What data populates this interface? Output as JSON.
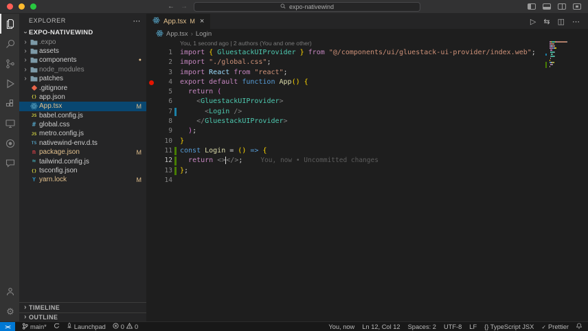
{
  "titlebar": {
    "search_value": "expo-nativewind"
  },
  "activity_bar": {
    "items": [
      "explorer",
      "search",
      "source-control",
      "run-and-debug",
      "extensions",
      "remote-explorer",
      "live-share",
      "chat"
    ],
    "bottom_items": [
      "accounts",
      "settings"
    ]
  },
  "sidebar": {
    "header": "EXPLORER",
    "root": {
      "label": "EXPO-NATIVEWIND"
    },
    "files": [
      {
        "label": ".expo",
        "kind": "folder",
        "icon": "folder",
        "dim": true
      },
      {
        "label": "assets",
        "kind": "folder",
        "icon": "folder"
      },
      {
        "label": "components",
        "kind": "folder",
        "icon": "folder",
        "badge": "●"
      },
      {
        "label": "node_modules",
        "kind": "folder",
        "icon": "folder",
        "dim": true
      },
      {
        "label": "patches",
        "kind": "folder",
        "icon": "folder"
      },
      {
        "label": ".gitignore",
        "kind": "file",
        "icon": "git"
      },
      {
        "label": "app.json",
        "kind": "file",
        "icon": "json"
      },
      {
        "label": "App.tsx",
        "kind": "file",
        "icon": "react",
        "badge": "M",
        "selected": true,
        "modified": true
      },
      {
        "label": "babel.config.js",
        "kind": "file",
        "icon": "js"
      },
      {
        "label": "global.css",
        "kind": "file",
        "icon": "css"
      },
      {
        "label": "metro.config.js",
        "kind": "file",
        "icon": "js"
      },
      {
        "label": "nativewind-env.d.ts",
        "kind": "file",
        "icon": "ts"
      },
      {
        "label": "package.json",
        "kind": "file",
        "icon": "npm",
        "badge": "M",
        "modified": true
      },
      {
        "label": "tailwind.config.js",
        "kind": "file",
        "icon": "tailwind"
      },
      {
        "label": "tsconfig.json",
        "kind": "file",
        "icon": "json"
      },
      {
        "label": "yarn.lock",
        "kind": "file",
        "icon": "yarn",
        "badge": "M",
        "modified": true
      }
    ],
    "panels": [
      {
        "label": "TIMELINE"
      },
      {
        "label": "OUTLINE"
      }
    ]
  },
  "editor": {
    "tabs": [
      {
        "label": "App.tsx",
        "git_badge": "M",
        "icon": "react"
      }
    ],
    "breadcrumb": [
      {
        "label": "App.tsx"
      },
      {
        "label": "Login"
      }
    ],
    "codelens": "You, 1 second ago | 2 authors (You and one other)",
    "inline_blame": "You, now • Uncommitted changes",
    "cursor": {
      "line": 12,
      "col": 12
    },
    "breakpoint_line": 4,
    "lines": [
      {
        "n": 1,
        "tk": [
          [
            "kw",
            "import "
          ],
          [
            "b1",
            "{ "
          ],
          [
            "ty",
            "GluestackUIProvider"
          ],
          [
            "b1",
            " }"
          ],
          [
            "kw",
            " from "
          ],
          [
            "st",
            "\"@/components/ui/gluestack-ui-provider/index.web\""
          ],
          [
            "pl",
            ";"
          ]
        ]
      },
      {
        "n": 2,
        "tk": [
          [
            "kw",
            "import "
          ],
          [
            "st",
            "\"./global.css\""
          ],
          [
            "pl",
            ";"
          ]
        ]
      },
      {
        "n": 3,
        "tk": [
          [
            "kw",
            "import "
          ],
          [
            "id",
            "React"
          ],
          [
            "kw",
            " from "
          ],
          [
            "st",
            "\"react\""
          ],
          [
            "pl",
            ";"
          ]
        ]
      },
      {
        "n": 4,
        "bp": true,
        "tk": [
          [
            "kw",
            "export default "
          ],
          [
            "k2",
            "function "
          ],
          [
            "fn",
            "App"
          ],
          [
            "b1",
            "()"
          ],
          [
            "pl",
            " "
          ],
          [
            "b1",
            "{"
          ]
        ]
      },
      {
        "n": 5,
        "tk": [
          [
            "pl",
            "  "
          ],
          [
            "kw",
            "return "
          ],
          [
            "b2",
            "("
          ]
        ]
      },
      {
        "n": 6,
        "tk": [
          [
            "pl",
            "    "
          ],
          [
            "tg",
            "<"
          ],
          [
            "ty",
            "GluestackUIProvider"
          ],
          [
            "tg",
            ">"
          ]
        ]
      },
      {
        "n": 7,
        "chg": "mod",
        "tk": [
          [
            "pl",
            "      "
          ],
          [
            "tg",
            "<"
          ],
          [
            "ty",
            "Login"
          ],
          [
            "tg",
            " />"
          ]
        ]
      },
      {
        "n": 8,
        "tk": [
          [
            "pl",
            "    "
          ],
          [
            "tg",
            "</"
          ],
          [
            "ty",
            "GluestackUIProvider"
          ],
          [
            "tg",
            ">"
          ]
        ]
      },
      {
        "n": 9,
        "tk": [
          [
            "pl",
            "  "
          ],
          [
            "b2",
            ")"
          ],
          [
            "pl",
            ";"
          ]
        ]
      },
      {
        "n": 10,
        "tk": [
          [
            "b1",
            "}"
          ]
        ]
      },
      {
        "n": 11,
        "chg": "add",
        "tk": [
          [
            "k2",
            "const "
          ],
          [
            "fn",
            "Login"
          ],
          [
            "pl",
            " = "
          ],
          [
            "b1",
            "()"
          ],
          [
            "k2",
            " =>"
          ],
          [
            "pl",
            " "
          ],
          [
            "b1",
            "{"
          ]
        ]
      },
      {
        "n": 12,
        "chg": "add",
        "active": true,
        "tk": [
          [
            "pl",
            "  "
          ],
          [
            "kw",
            "return "
          ],
          [
            "tg",
            "<>"
          ],
          [
            "cu",
            ""
          ],
          [
            "tg",
            "</>"
          ],
          [
            "pl",
            ";"
          ],
          [
            "gh",
            "You, now • Uncommitted changes"
          ]
        ]
      },
      {
        "n": 13,
        "chg": "add",
        "tk": [
          [
            "b1",
            "}"
          ],
          [
            "pl",
            ";"
          ]
        ]
      },
      {
        "n": 14,
        "tk": []
      }
    ]
  },
  "status_bar": {
    "left": [
      {
        "name": "remote-indicator",
        "segments": [
          [
            "icon",
            "remote"
          ]
        ]
      },
      {
        "name": "git-branch",
        "segments": [
          [
            "icon",
            "branch"
          ],
          [
            "text",
            "main*"
          ]
        ]
      },
      {
        "name": "sync-changes",
        "segments": [
          [
            "icon",
            "sync"
          ]
        ]
      },
      {
        "name": "launchpad",
        "segments": [
          [
            "icon",
            "rocket"
          ],
          [
            "text",
            "Launchpad"
          ]
        ]
      },
      {
        "name": "problems",
        "segments": [
          [
            "icon",
            "error"
          ],
          [
            "text",
            "0"
          ],
          [
            "icon",
            "warning"
          ],
          [
            "text",
            "0"
          ]
        ]
      }
    ],
    "right": [
      {
        "name": "git-blame",
        "segments": [
          [
            "text",
            "You, now"
          ]
        ]
      },
      {
        "name": "cursor-position",
        "segments": [
          [
            "text",
            "Ln 12, Col 12"
          ]
        ]
      },
      {
        "name": "indentation",
        "segments": [
          [
            "text",
            "Spaces: 2"
          ]
        ]
      },
      {
        "name": "encoding",
        "segments": [
          [
            "text",
            "UTF-8"
          ]
        ]
      },
      {
        "name": "eol",
        "segments": [
          [
            "text",
            "LF"
          ]
        ]
      },
      {
        "name": "language-mode",
        "segments": [
          [
            "text",
            "{} TypeScript JSX"
          ]
        ]
      },
      {
        "name": "prettier",
        "segments": [
          [
            "icon",
            "check"
          ],
          [
            "text",
            "Prettier"
          ]
        ]
      },
      {
        "name": "notifications",
        "segments": [
          [
            "icon",
            "bell"
          ]
        ]
      }
    ]
  }
}
